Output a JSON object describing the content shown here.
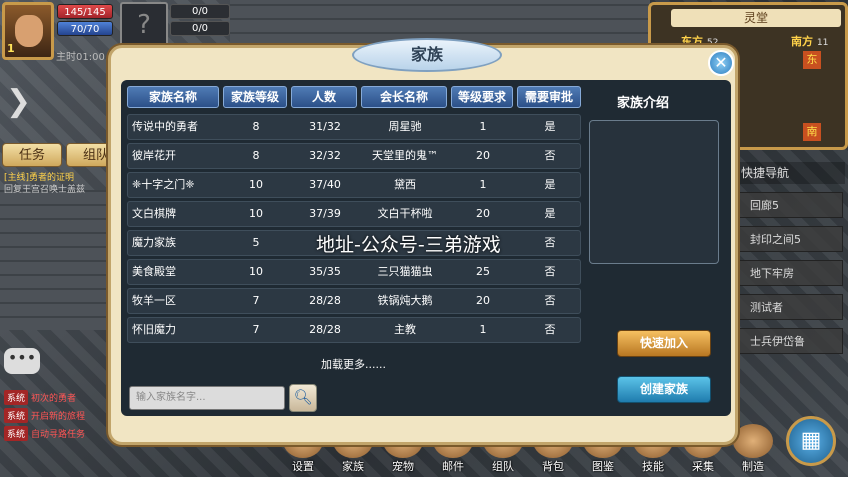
{
  "hud": {
    "hp": "145/145",
    "mp": "70/70",
    "level": "1",
    "pet_hp": "0/0",
    "pet_mp": "0/0",
    "clock": "主时01:00",
    "pet_placeholder": "?"
  },
  "side": {
    "tab_task": "任务",
    "tab_team": "组队",
    "quest_title": "[主线]勇者的证明",
    "quest_desc": "回复王宫召唤士盖兹"
  },
  "system_msgs": [
    {
      "tag": "系统",
      "text": "初次的勇者"
    },
    {
      "tag": "系统",
      "text": "开启新的旅程"
    },
    {
      "tag": "系统",
      "text": "自动寻路任务"
    }
  ],
  "map": {
    "name": "灵堂",
    "east_label": "东方",
    "east_val": "52",
    "south_label": "南方",
    "south_val": "11",
    "exit_east": "东",
    "exit_south": "南"
  },
  "nav": {
    "title": "快捷导航",
    "items": [
      "回廊5",
      "封印之间5",
      "地下牢房",
      "测试者",
      "士兵伊岱鲁"
    ]
  },
  "menu": [
    "设置",
    "家族",
    "宠物",
    "邮件",
    "组队",
    "背包",
    "图鉴",
    "技能",
    "采集",
    "制造"
  ],
  "dialog": {
    "title": "家族",
    "headers": [
      "家族名称",
      "家族等级",
      "人数",
      "会长名称",
      "等级要求",
      "需要审批"
    ],
    "rows": [
      [
        "传说中的勇者",
        "8",
        "31/32",
        "周星驰",
        "1",
        "是"
      ],
      [
        "彼岸花开",
        "8",
        "32/32",
        "天堂里的鬼™",
        "20",
        "否"
      ],
      [
        "❈十字之门❈",
        "10",
        "37/40",
        "黛西",
        "1",
        "是"
      ],
      [
        "文白棋牌",
        "10",
        "37/39",
        "文白干杯啦",
        "20",
        "是"
      ],
      [
        "魔力家族",
        "5",
        "",
        "",
        "",
        "否"
      ],
      [
        "美食殿堂",
        "10",
        "35/35",
        "三只猫猫虫",
        "25",
        "否"
      ],
      [
        "牧羊一区",
        "7",
        "28/28",
        "铁锅炖大鹅",
        "20",
        "否"
      ],
      [
        "怀旧魔力",
        "7",
        "28/28",
        "主教",
        "1",
        "否"
      ]
    ],
    "load_more": "加载更多......",
    "intro_title": "家族介绍",
    "quick_join": "快速加入",
    "create": "创建家族",
    "search_placeholder": "输入家族名字..."
  },
  "watermark": "地址-公众号-三弟游戏"
}
